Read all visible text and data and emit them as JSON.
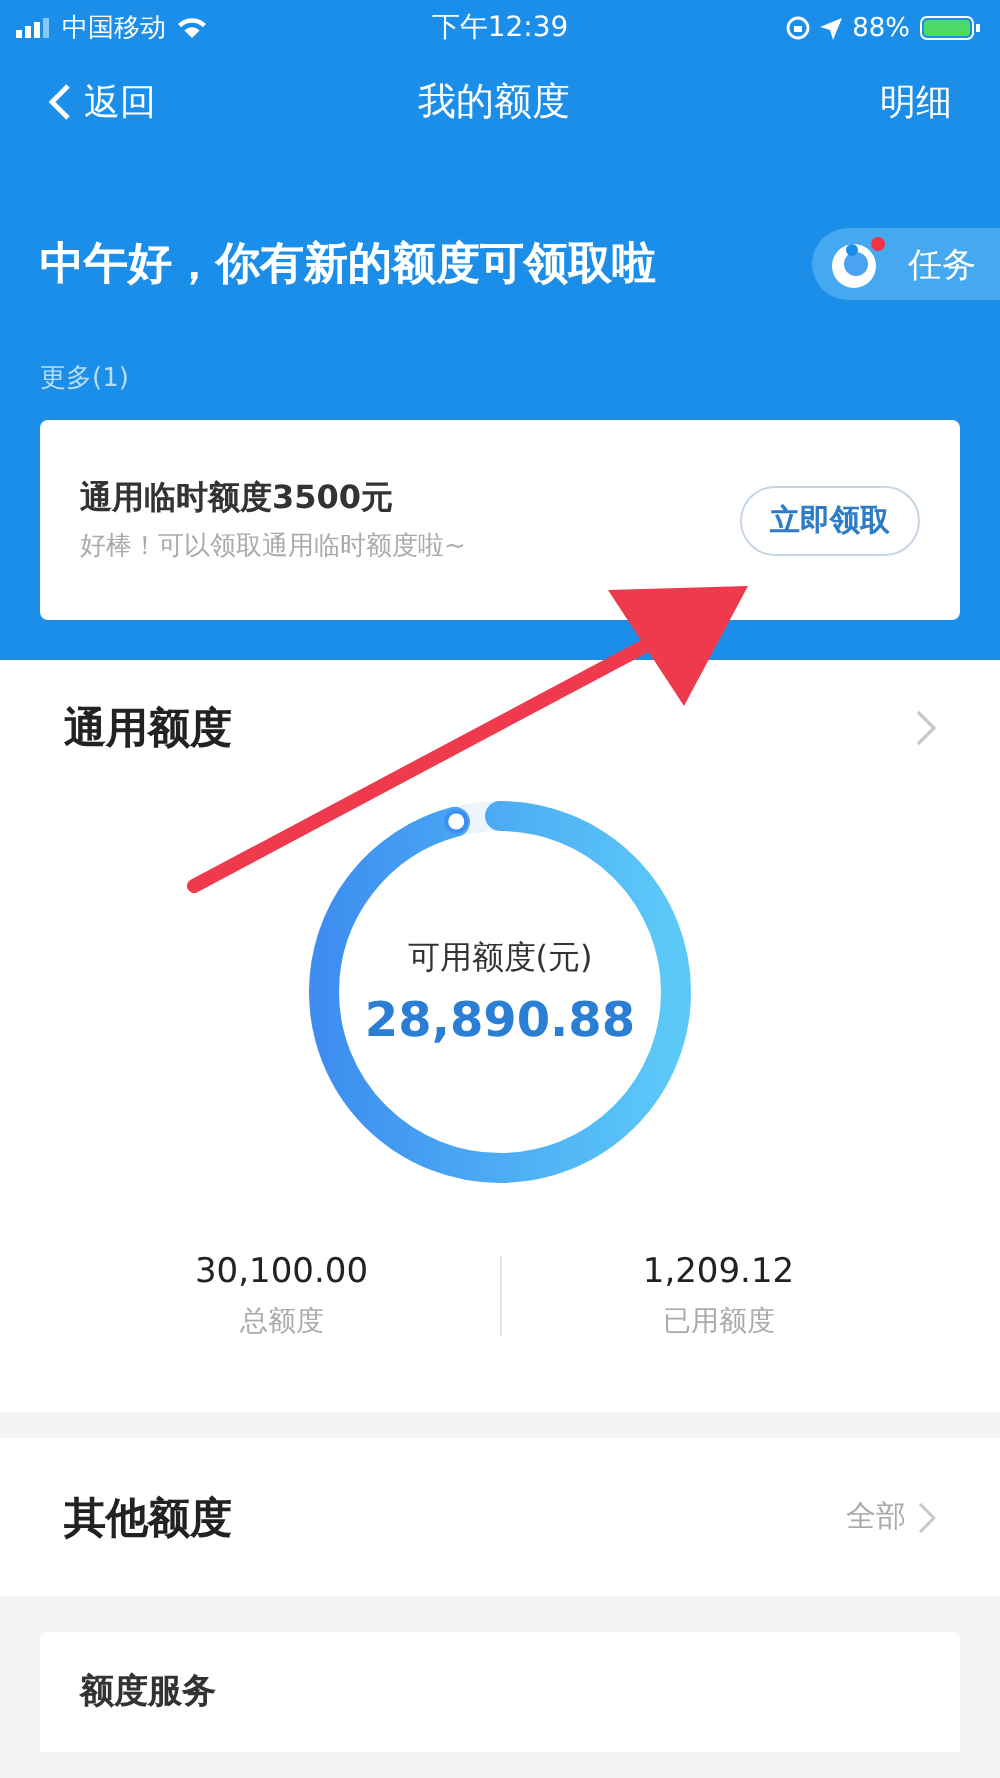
{
  "status_bar": {
    "carrier": "中国移动",
    "time": "下午12:39",
    "battery": "88%"
  },
  "nav": {
    "back": "返回",
    "title": "我的额度",
    "action": "明细"
  },
  "greeting": "中午好，你有新的额度可领取啦",
  "task_button": {
    "label": "任务",
    "badge": true
  },
  "more": "更多(1)",
  "offer": {
    "title": "通用临时额度3500元",
    "subtitle": "好棒！可以领取通用临时额度啦~",
    "button": "立即领取"
  },
  "general_quota": {
    "title": "通用额度",
    "ring_label": "可用额度(元)",
    "available": "28,890.88",
    "level": 0.96,
    "stats": [
      {
        "value": "30,100.00",
        "label": "总额度"
      },
      {
        "value": "1,209.12",
        "label": "已用额度"
      }
    ]
  },
  "other_quota": {
    "title": "其他额度",
    "link": "全部"
  },
  "services": {
    "title": "额度服务"
  }
}
